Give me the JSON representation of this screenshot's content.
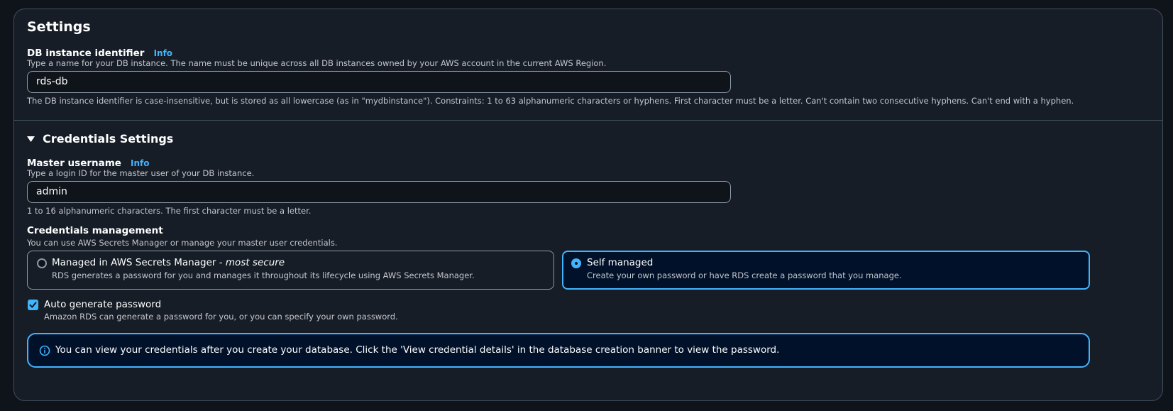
{
  "settings": {
    "title": "Settings",
    "db_identifier": {
      "label": "DB instance identifier",
      "info": "Info",
      "description": "Type a name for your DB instance. The name must be unique across all DB instances owned by your AWS account in the current AWS Region.",
      "value": "rds-db",
      "constraint": "The DB instance identifier is case-insensitive, but is stored as all lowercase (as in \"mydbinstance\"). Constraints: 1 to 63 alphanumeric characters or hyphens. First character must be a letter. Can't contain two consecutive hyphens. Can't end with a hyphen."
    }
  },
  "credentials": {
    "title": "Credentials Settings",
    "master_username": {
      "label": "Master username",
      "info": "Info",
      "description": "Type a login ID for the master user of your DB instance.",
      "value": "admin",
      "constraint": "1 to 16 alphanumeric characters. The first character must be a letter."
    },
    "management": {
      "label": "Credentials management",
      "description": "You can use AWS Secrets Manager or manage your master user credentials.",
      "options": [
        {
          "title": "Managed in AWS Secrets Manager - ",
          "title_em": "most secure",
          "description": "RDS generates a password for you and manages it throughout its lifecycle using AWS Secrets Manager.",
          "selected": false
        },
        {
          "title": "Self managed",
          "description": "Create your own password or have RDS create a password that you manage.",
          "selected": true
        }
      ]
    },
    "auto_generate": {
      "label": "Auto generate password",
      "description": "Amazon RDS can generate a password for you, or you can specify your own password.",
      "checked": true
    },
    "alert": {
      "text": "You can view your credentials after you create your database. Click the 'View credential details' in the database creation banner to view the password."
    }
  },
  "colors": {
    "accent": "#42b4ff",
    "background": "#0f141a",
    "panel": "#161d26",
    "border": "#414d5c"
  }
}
